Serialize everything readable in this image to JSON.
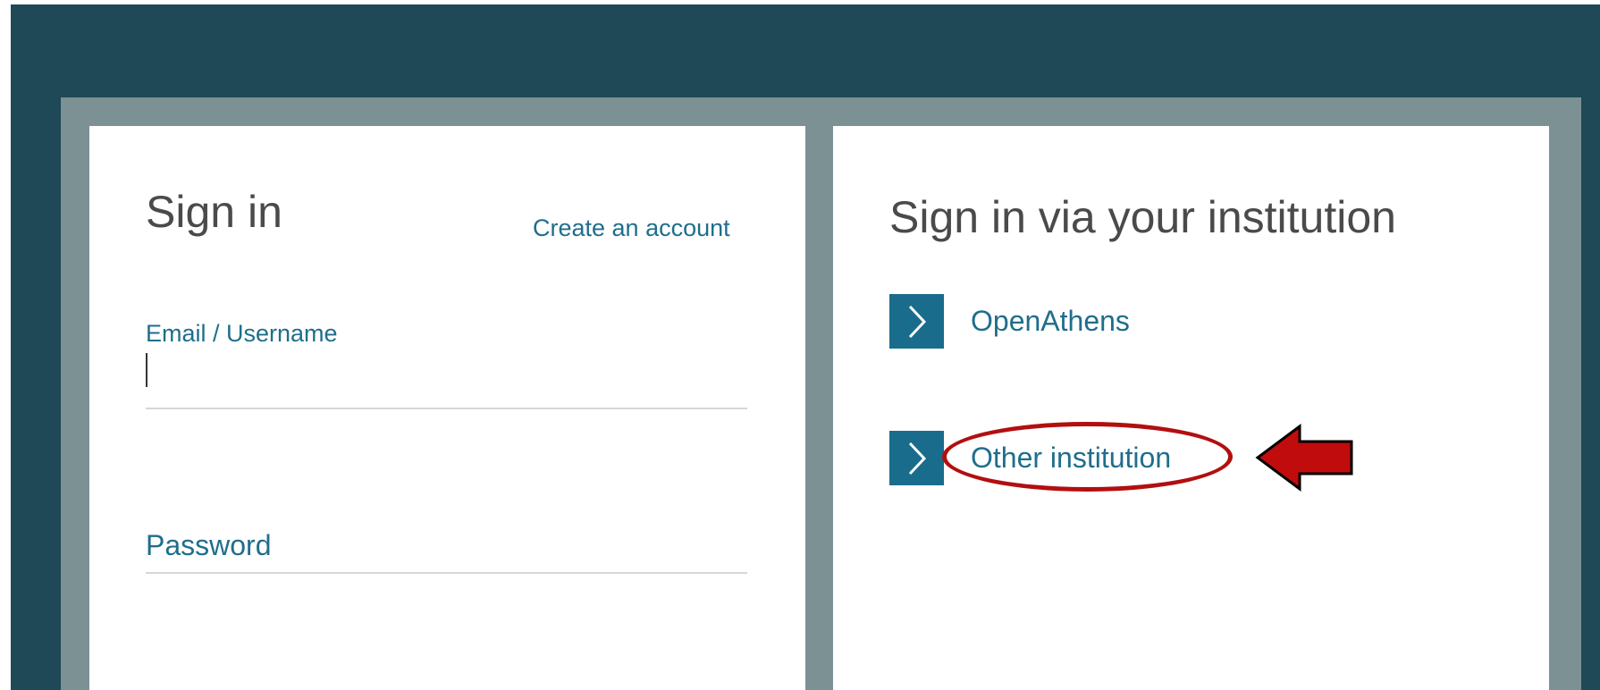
{
  "signin": {
    "title": "Sign in",
    "create_account_link": "Create an account",
    "email_label": "Email / Username",
    "email_value": "",
    "password_placeholder": "Password"
  },
  "institution": {
    "title": "Sign in via your institution",
    "options": [
      {
        "label": "OpenAthens",
        "icon": "chevron-right-icon"
      },
      {
        "label": "Other institution",
        "icon": "chevron-right-icon"
      }
    ]
  },
  "colors": {
    "page_background": "#1f4957",
    "frame": "#7c9194",
    "panel": "#ffffff",
    "accent": "#1a6c8c",
    "link_text": "#1f6e8c",
    "heading_text": "#4a4a4a",
    "annotation": "#b20f0f"
  },
  "annotations": {
    "highlighted_option": "Other institution",
    "highlight_shape": "ellipse",
    "pointer": "left-arrow"
  }
}
